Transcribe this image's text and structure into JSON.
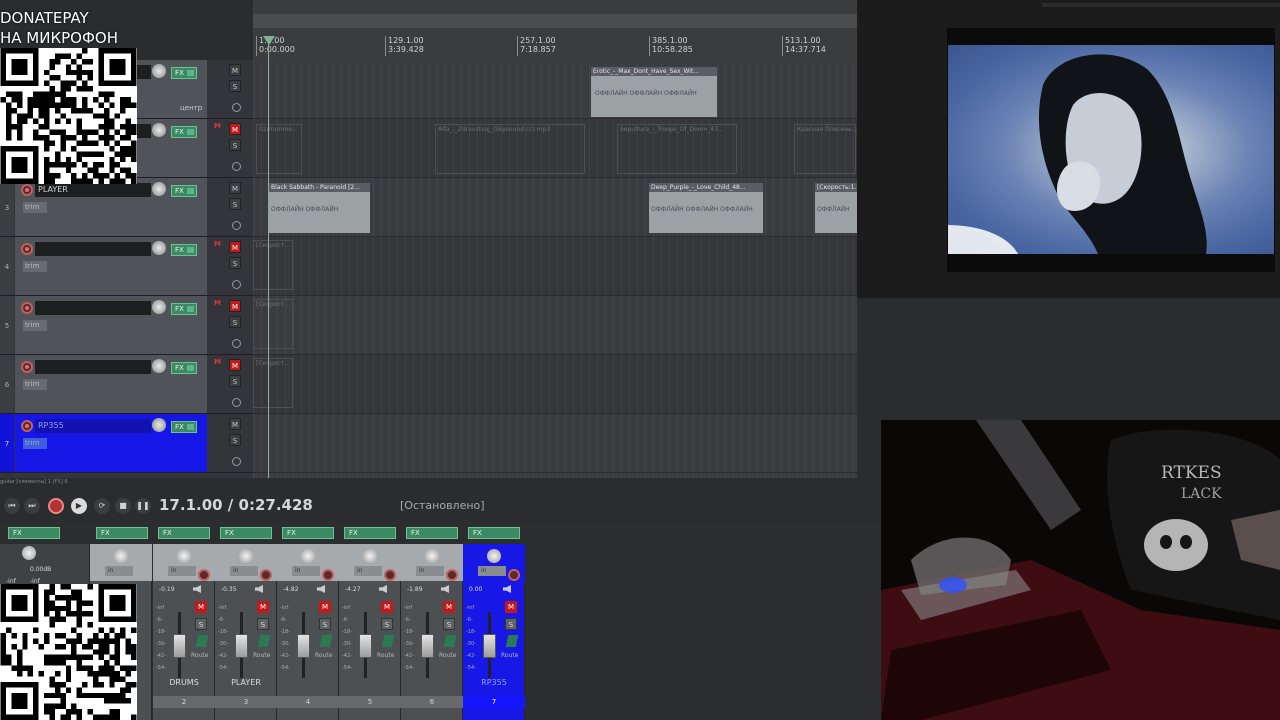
{
  "overlay": {
    "donate_line1": "DONATEPAY",
    "donate_line2": "НА МИКРОФОН"
  },
  "ruler": {
    "marks": [
      {
        "bar": "1.1.00",
        "time": "0:00.000"
      },
      {
        "bar": "129.1.00",
        "time": "3:39.428"
      },
      {
        "bar": "257.1.00",
        "time": "7:18.857"
      },
      {
        "bar": "385.1.00",
        "time": "10:58.285"
      },
      {
        "bar": "513.1.00",
        "time": "14:37.714"
      }
    ]
  },
  "tracks": [
    {
      "num": "1",
      "name": "",
      "extra": "центр",
      "mute_on": false,
      "selected": false
    },
    {
      "num": "2",
      "name": "",
      "extra": "",
      "mute_on": true,
      "selected": false
    },
    {
      "num": "3",
      "name": "PLAYER",
      "trim": "trim",
      "mute_on": false,
      "selected": false
    },
    {
      "num": "4",
      "name": "",
      "trim": "trim",
      "mute_on": true,
      "selected": false
    },
    {
      "num": "5",
      "name": "",
      "trim": "trim",
      "mute_on": true,
      "selected": false
    },
    {
      "num": "6",
      "name": "",
      "trim": "trim",
      "mute_on": true,
      "selected": false
    },
    {
      "num": "7",
      "name": "RP355",
      "trim": "trim",
      "mute_on": false,
      "selected": true
    }
  ],
  "track_controls": {
    "fx": "FX",
    "mute": "M",
    "solo": "S",
    "m_label": "M"
  },
  "items": {
    "lane1": [
      {
        "title": "Erotic_-_Max_Dont_Have_Sex_Wit...",
        "wave": "ОФФЛАЙН  ОФФЛАЙН  ОФФЛАЙН"
      }
    ],
    "lane2": [
      {
        "title": "02drumme..."
      },
      {
        "title": "Alfa_-_Zdravstvuj_(Skysound.cc).mp3"
      },
      {
        "title": "Sepultura_-_Troops_Of_Doom_47..."
      },
      {
        "title": "Красная Плесень..."
      }
    ],
    "lane3": [
      {
        "title": "Black Sabbath - Paranoid [2...",
        "wave": "ОФФЛАЙН   ОФФЛАЙН"
      },
      {
        "title": "Deep_Purple_-_Love_Child_48...",
        "wave": "ОФФЛАЙН  ОФФЛАЙН  ОФФЛАЙН"
      },
      {
        "title": "[Скорость:1...",
        "wave": "ОФФЛАЙН"
      }
    ],
    "lane4": [
      {
        "title": "[Скорост..."
      }
    ],
    "lane5": [
      {
        "title": "[Скорост..."
      }
    ],
    "lane6": [
      {
        "title": "[Скорост..."
      }
    ]
  },
  "status_line": "guitar [элементы] 1 [FX] 6",
  "transport": {
    "timecode": "17.1.00 / 0:27.428",
    "state": "[Остановлено]",
    "btn_start": "⏮",
    "btn_end": "⏭",
    "btn_loop": "⟳",
    "btn_stop": "■",
    "btn_pause": "❚❚",
    "btn_play": "▶"
  },
  "mixer": {
    "master": {
      "db": "0.00dB",
      "inf1": "-inf",
      "inf2": "-inf"
    },
    "strips": [
      {
        "name": "DRUMS",
        "num": "2",
        "db": "-0.19",
        "selected": false
      },
      {
        "name": "PLAYER",
        "num": "3",
        "db": "-0.35",
        "selected": false
      },
      {
        "name": "",
        "num": "4",
        "db": "-4.82",
        "selected": false
      },
      {
        "name": "",
        "num": "5",
        "db": "-4.27",
        "selected": false
      },
      {
        "name": "",
        "num": "6",
        "db": "-1.89",
        "selected": false
      },
      {
        "name": "RP355",
        "num": "7",
        "db": "0.00",
        "selected": true
      }
    ],
    "fx": "FX",
    "in": "in",
    "route": "Route",
    "m": "M",
    "s": "S",
    "scale": [
      "-inf",
      "-6-",
      "-18-",
      "-30-",
      "-42-",
      "-54-"
    ]
  }
}
